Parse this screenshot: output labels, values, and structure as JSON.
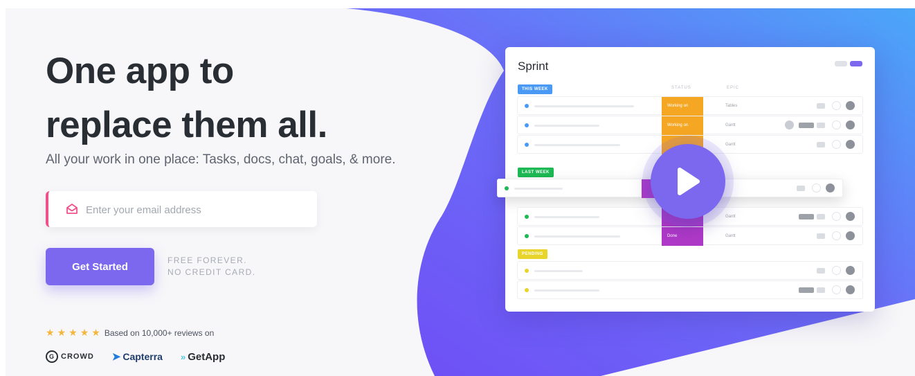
{
  "hero": {
    "title_line1": "One app to",
    "title_line2": "replace them all.",
    "subtitle": "All your work in one place: Tasks, docs, chat, goals, & more."
  },
  "signup": {
    "email_placeholder": "Enter your email address",
    "cta_label": "Get Started",
    "free_line1": "FREE FOREVER.",
    "free_line2": "NO CREDIT CARD."
  },
  "reviews": {
    "stars": 5,
    "text": "Based on 10,000+ reviews on",
    "logos": [
      "CROWD",
      "Capterra",
      "GetApp"
    ]
  },
  "preview": {
    "title": "Sprint",
    "col_status": "STATUS",
    "col_epic": "EPIC",
    "groups": [
      {
        "label": "THIS WEEK",
        "color": "#4a9af5",
        "rows": [
          {
            "status": "Working on",
            "status_color": "#f5a623",
            "epic": "Tables"
          },
          {
            "status": "Working on",
            "status_color": "#f5a623",
            "epic": "Gantt"
          },
          {
            "status": "",
            "status_color": "#f5a623",
            "epic": "Gantt"
          }
        ]
      },
      {
        "label": "LAST WEEK",
        "color": "#1db954",
        "rows": [
          {
            "status": "",
            "status_color": "#b039c8",
            "epic": ""
          },
          {
            "status": "",
            "status_color": "#b039c8",
            "epic": "Gantt"
          },
          {
            "status": "Done",
            "status_color": "#b039c8",
            "epic": "Gantt"
          }
        ]
      },
      {
        "label": "PENDING",
        "color": "#e8d42a",
        "rows": [
          {
            "status": "",
            "status_color": "",
            "epic": ""
          },
          {
            "status": "",
            "status_color": "",
            "epic": ""
          }
        ]
      }
    ]
  },
  "colors": {
    "brand": "#7b68ee",
    "title": "#292d34",
    "accent_pink": "#f0508a",
    "star": "#f4b63b"
  },
  "icons": [
    "envelope-icon",
    "star-icon",
    "play-icon",
    "g2-crowd-logo",
    "capterra-logo",
    "getapp-logo"
  ]
}
